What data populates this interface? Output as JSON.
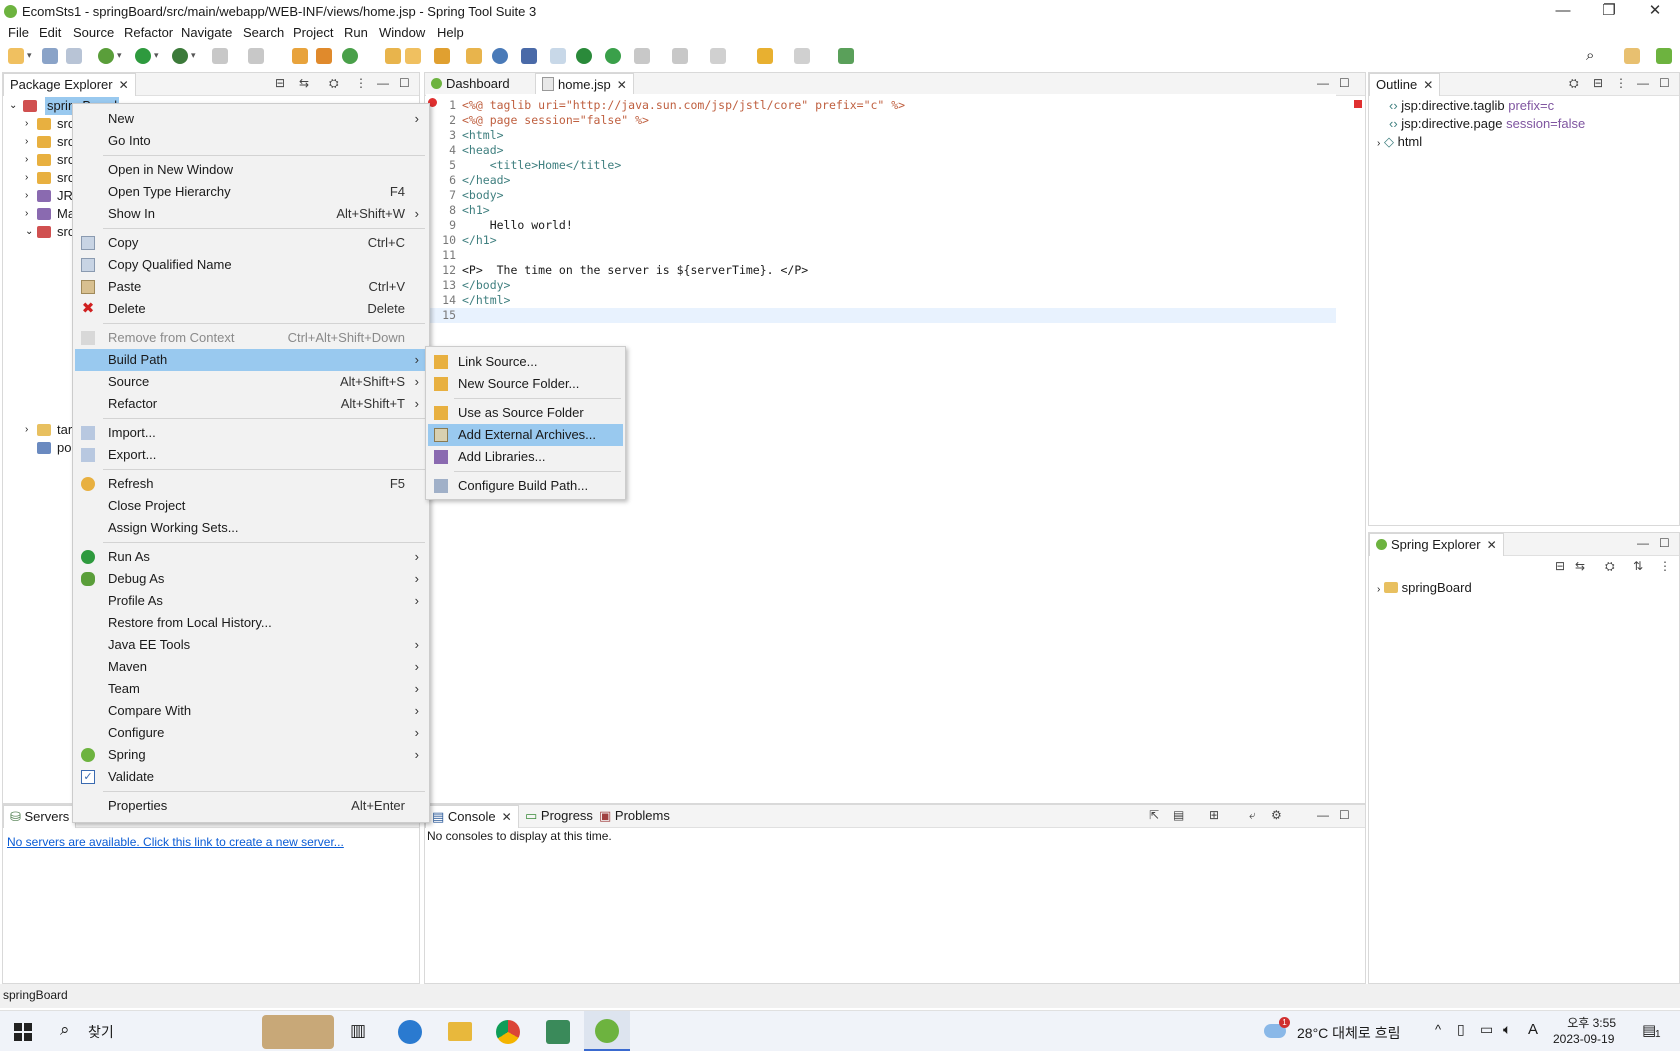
{
  "window": {
    "title": "EcomSts1 - springBoard/src/main/webapp/WEB-INF/views/home.jsp - Spring Tool Suite 3",
    "minimize": "—",
    "restore": "❐",
    "close": "✕"
  },
  "menubar": [
    "File",
    "Edit",
    "Source",
    "Refactor",
    "Navigate",
    "Search",
    "Project",
    "Run",
    "Window",
    "Help"
  ],
  "package_explorer": {
    "tab": "Package Explorer",
    "root": "springBoard",
    "items": [
      "src",
      "src",
      "src",
      "src",
      "JRE",
      "Ma",
      "src",
      "tar",
      "po"
    ]
  },
  "editor": {
    "tabs": [
      "Dashboard",
      "home.jsp"
    ],
    "lines": [
      {
        "n": "1",
        "text": "<%@ taglib uri=\"http://java.sun.com/jsp/jstl/core\" prefix=\"c\" %>"
      },
      {
        "n": "2",
        "text": "<%@ page session=\"false\" %>"
      },
      {
        "n": "3",
        "text": "<html>"
      },
      {
        "n": "4",
        "text": "<head>"
      },
      {
        "n": "5",
        "text": "    <title>Home</title>"
      },
      {
        "n": "6",
        "text": "</head>"
      },
      {
        "n": "7",
        "text": "<body>"
      },
      {
        "n": "8",
        "text": "<h1>"
      },
      {
        "n": "9",
        "text": "    Hello world!"
      },
      {
        "n": "10",
        "text": "</h1>"
      },
      {
        "n": "11",
        "text": ""
      },
      {
        "n": "12",
        "text": "<P>  The time on the server is ${serverTime}. </P>"
      },
      {
        "n": "13",
        "text": "</body>"
      },
      {
        "n": "14",
        "text": "</html>"
      },
      {
        "n": "15",
        "text": ""
      }
    ]
  },
  "outline": {
    "tab": "Outline",
    "items": [
      {
        "name": "jsp:directive.taglib",
        "detail": "prefix=c"
      },
      {
        "name": "jsp:directive.page",
        "detail": "session=false"
      },
      {
        "name": "html",
        "detail": ""
      }
    ]
  },
  "spring_explorer": {
    "tab": "Spring Explorer",
    "items": [
      "springBoard"
    ]
  },
  "servers": {
    "tab": "Servers",
    "link": "No servers are available. Click this link to create a new server..."
  },
  "console": {
    "tabs": [
      "Console",
      "Progress",
      "Problems"
    ],
    "message": "No consoles to display at this time."
  },
  "context_menu": {
    "items": [
      {
        "label": "New",
        "shortcut": "",
        "submenu": true
      },
      {
        "label": "Go Into",
        "shortcut": ""
      },
      {
        "label": "Open in New Window",
        "shortcut": ""
      },
      {
        "label": "Open Type Hierarchy",
        "shortcut": "F4"
      },
      {
        "label": "Show In",
        "shortcut": "Alt+Shift+W",
        "submenu": true
      },
      {
        "label": "Copy",
        "shortcut": "Ctrl+C"
      },
      {
        "label": "Copy Qualified Name",
        "shortcut": ""
      },
      {
        "label": "Paste",
        "shortcut": "Ctrl+V"
      },
      {
        "label": "Delete",
        "shortcut": "Delete"
      },
      {
        "label": "Remove from Context",
        "shortcut": "Ctrl+Alt+Shift+Down"
      },
      {
        "label": "Build Path",
        "shortcut": "",
        "submenu": true
      },
      {
        "label": "Source",
        "shortcut": "Alt+Shift+S",
        "submenu": true
      },
      {
        "label": "Refactor",
        "shortcut": "Alt+Shift+T",
        "submenu": true
      },
      {
        "label": "Import...",
        "shortcut": ""
      },
      {
        "label": "Export...",
        "shortcut": ""
      },
      {
        "label": "Refresh",
        "shortcut": "F5"
      },
      {
        "label": "Close Project",
        "shortcut": ""
      },
      {
        "label": "Assign Working Sets...",
        "shortcut": ""
      },
      {
        "label": "Run As",
        "shortcut": "",
        "submenu": true
      },
      {
        "label": "Debug As",
        "shortcut": "",
        "submenu": true
      },
      {
        "label": "Profile As",
        "shortcut": "",
        "submenu": true
      },
      {
        "label": "Restore from Local History...",
        "shortcut": ""
      },
      {
        "label": "Java EE Tools",
        "shortcut": "",
        "submenu": true
      },
      {
        "label": "Maven",
        "shortcut": "",
        "submenu": true
      },
      {
        "label": "Team",
        "shortcut": "",
        "submenu": true
      },
      {
        "label": "Compare With",
        "shortcut": "",
        "submenu": true
      },
      {
        "label": "Configure",
        "shortcut": "",
        "submenu": true
      },
      {
        "label": "Spring",
        "shortcut": "",
        "submenu": true
      },
      {
        "label": "Validate",
        "shortcut": ""
      },
      {
        "label": "Properties",
        "shortcut": "Alt+Enter"
      }
    ]
  },
  "build_path_submenu": {
    "items": [
      "Link Source...",
      "New Source Folder...",
      "Use as Source Folder",
      "Add External Archives...",
      "Add Libraries...",
      "Configure Build Path..."
    ]
  },
  "statusbar": {
    "text": "springBoard"
  },
  "taskbar": {
    "search": "찾기",
    "weather": "28°C  대체로 흐림",
    "time": "오후 3:55",
    "date": "2023-09-19",
    "notification_count": "1",
    "ime": "A"
  },
  "colors": {
    "highlight": "#99c9ef",
    "spring_green": "#6db33f",
    "link": "#0b5cd5"
  }
}
